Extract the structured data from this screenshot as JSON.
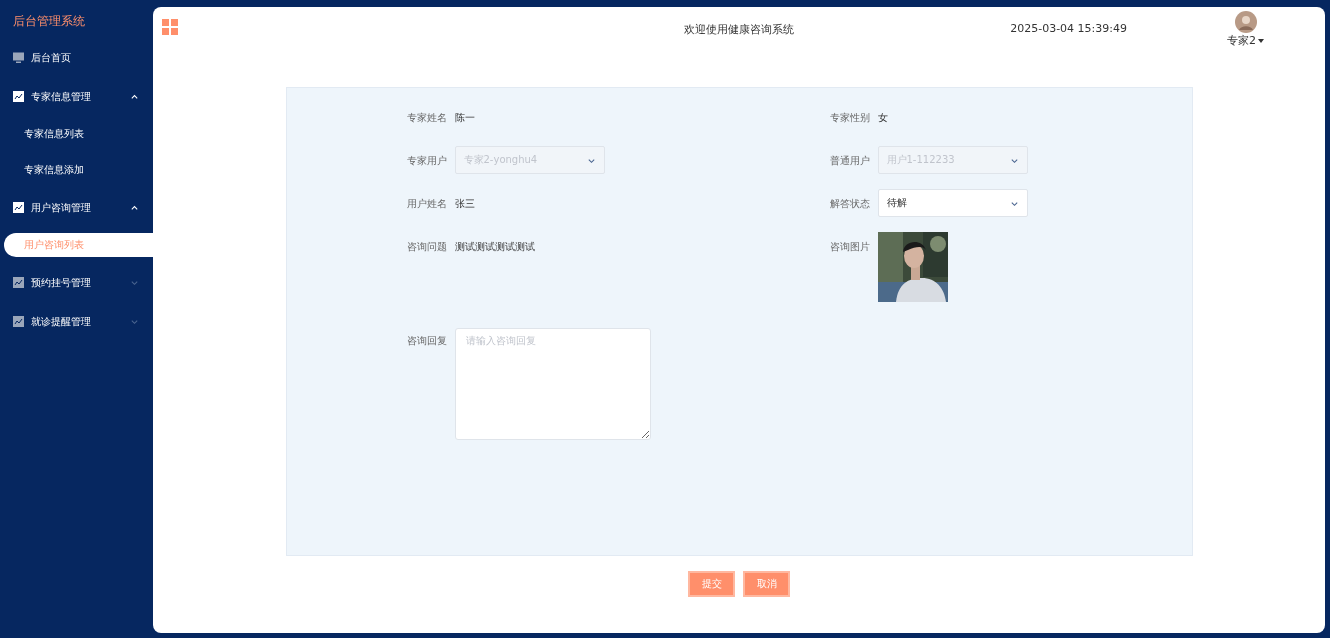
{
  "sidebar": {
    "title": "后台管理系统",
    "menu": [
      {
        "kind": "link",
        "label": "后台首页"
      },
      {
        "kind": "group",
        "label": "专家信息管理",
        "expanded": true,
        "children": [
          {
            "label": "专家信息列表",
            "selected": false
          },
          {
            "label": "专家信息添加",
            "selected": false
          }
        ]
      },
      {
        "kind": "group",
        "label": "用户咨询管理",
        "expanded": true,
        "children": [
          {
            "label": "用户咨询列表",
            "selected": true
          }
        ]
      },
      {
        "kind": "group",
        "label": "预约挂号管理",
        "expanded": false
      },
      {
        "kind": "group",
        "label": "就诊提醒管理",
        "expanded": false
      }
    ]
  },
  "header": {
    "title": "欢迎使用健康咨询系统",
    "datetime": "2025-03-04 15:39:49",
    "user": "专家2"
  },
  "form": {
    "fields": [
      {
        "kind": "text",
        "label": "专家姓名",
        "value": "陈一"
      },
      {
        "kind": "text",
        "label": "专家性别",
        "value": "女"
      },
      {
        "kind": "select",
        "label": "专家用户",
        "value": "专家2-yonghu4",
        "disabled": true
      },
      {
        "kind": "select",
        "label": "普通用户",
        "value": "用户1-112233",
        "disabled": true
      },
      {
        "kind": "text",
        "label": "用户姓名",
        "value": "张三"
      },
      {
        "kind": "select",
        "label": "解答状态",
        "value": "待解",
        "disabled": false
      },
      {
        "kind": "text",
        "label": "咨询问题",
        "value": "测试测试测试测试"
      },
      {
        "label": "咨询图片"
      },
      {
        "kind": "textarea",
        "label": "咨询回复",
        "placeholder": "请输入咨询回复"
      }
    ],
    "buttons": [
      "提交",
      "取消"
    ]
  }
}
